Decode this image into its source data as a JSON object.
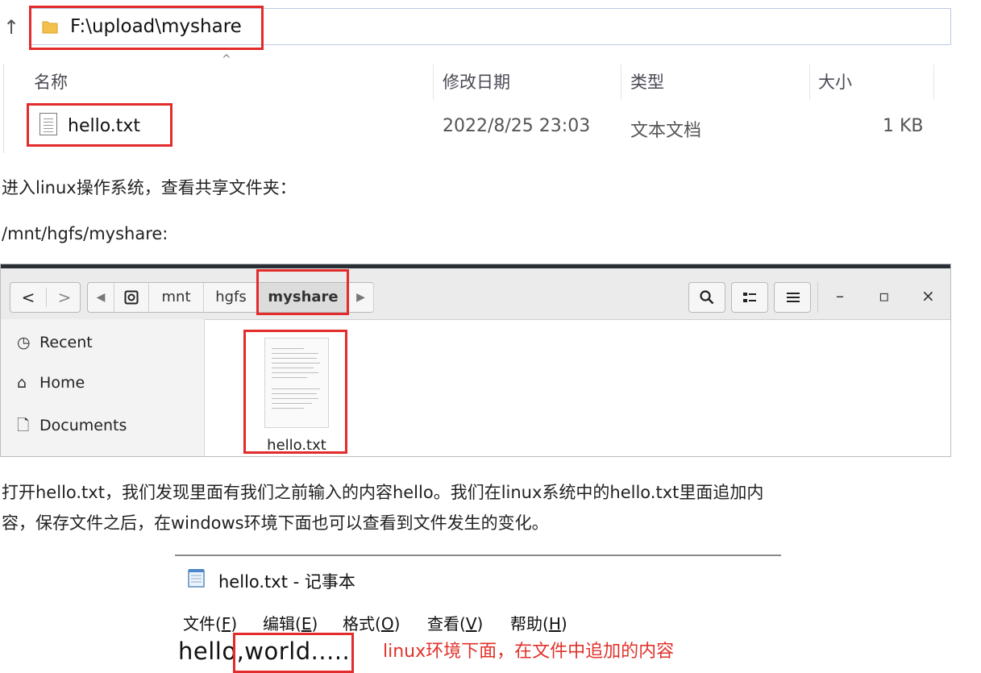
{
  "explorer": {
    "address": "F:\\upload\\myshare",
    "columns": {
      "name": "名称",
      "modified": "修改日期",
      "type": "类型",
      "size": "大小"
    },
    "file": {
      "name": "hello.txt",
      "modified": "2022/8/25 23:03",
      "type": "文本文档",
      "size": "1 KB"
    }
  },
  "para1": "进入linux操作系统，查看共享文件夹：",
  "para2": "/mnt/hgfs/myshare:",
  "linux": {
    "path": [
      "mnt",
      "hgfs",
      "myshare"
    ],
    "sidebar": [
      {
        "label": "Recent",
        "icon": "clock-icon"
      },
      {
        "label": "Home",
        "icon": "home-icon"
      },
      {
        "label": "Documents",
        "icon": "document-icon"
      }
    ],
    "file_label": "hello.txt",
    "buttons": {
      "back": "<",
      "forward": ">",
      "search": "search-icon",
      "view": "grid-icon",
      "menu": "hamburger-icon",
      "minimize": "–",
      "maximize": "▫",
      "close": "×"
    }
  },
  "para3_line1": "打开hello.txt，我们发现里面有我们之前输入的内容hello。我们在linux系统中的hello.txt里面追加内",
  "para3_line2": "容，保存文件之后，在windows环境下面也可以查看到文件发生的变化。",
  "notepad": {
    "title": "hello.txt - 记事本",
    "menu": [
      {
        "label": "文件(",
        "key": "F",
        "end": ")"
      },
      {
        "label": "编辑(",
        "key": "E",
        "end": ")"
      },
      {
        "label": "格式(",
        "key": "O",
        "end": ")"
      },
      {
        "label": "查看(",
        "key": "V",
        "end": ")"
      },
      {
        "label": "帮助(",
        "key": "H",
        "end": ")"
      }
    ],
    "content_before": "hello",
    "content_added": ",world.....",
    "annotation": "linux环境下面，在文件中追加的内容"
  },
  "colors": {
    "highlight": "#e32b2b",
    "annotation": "#e0322b"
  }
}
